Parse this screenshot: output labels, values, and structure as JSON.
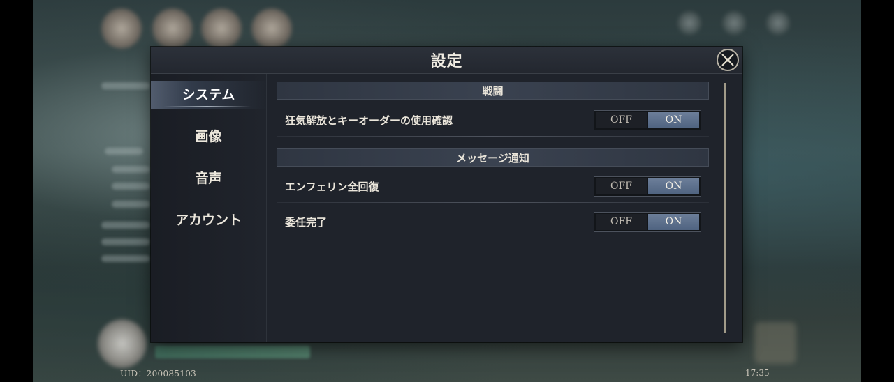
{
  "window": {
    "title": "設定"
  },
  "sidebar": {
    "items": [
      {
        "label": "システム",
        "active": true
      },
      {
        "label": "画像",
        "active": false
      },
      {
        "label": "音声",
        "active": false
      },
      {
        "label": "アカウント",
        "active": false
      }
    ]
  },
  "sections": [
    {
      "header": "戦闘",
      "settings": [
        {
          "label": "狂気解放とキーオーダーの使用確認",
          "off_label": "OFF",
          "on_label": "ON",
          "value": "ON"
        }
      ]
    },
    {
      "header": "メッセージ通知",
      "settings": [
        {
          "label": "エンフェリン全回復",
          "off_label": "OFF",
          "on_label": "ON",
          "value": "ON"
        },
        {
          "label": "委任完了",
          "off_label": "OFF",
          "on_label": "ON",
          "value": "ON"
        }
      ]
    }
  ],
  "footer": {
    "uid": "UID：200085103",
    "time": "17:35"
  },
  "colors": {
    "panel_bg": "#1f232b",
    "toggle_on": "#5a6d8a",
    "accent_gold": "#b8b09a"
  }
}
